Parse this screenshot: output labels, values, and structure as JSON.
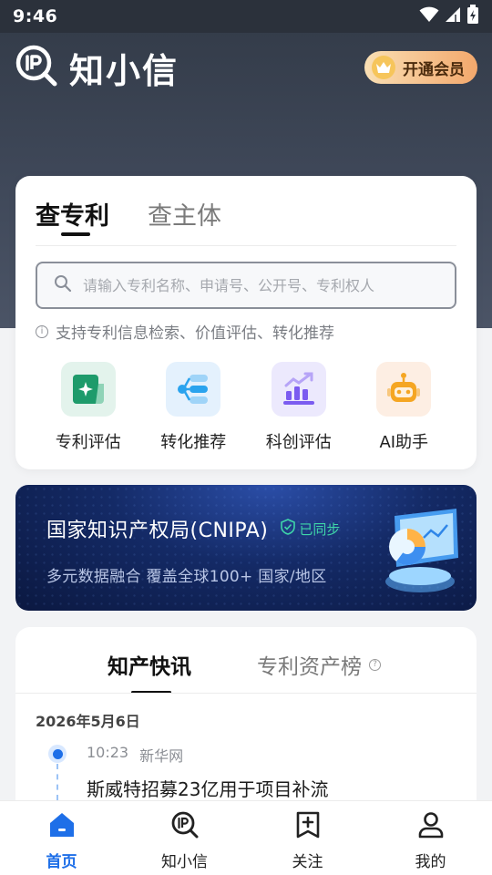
{
  "status_bar": {
    "time": "9:46"
  },
  "header": {
    "app_name": "知小信",
    "vip_label": "开通会员"
  },
  "search": {
    "tabs": [
      {
        "label": "查专利",
        "active": true
      },
      {
        "label": "查主体",
        "active": false
      }
    ],
    "placeholder": "请输入专利名称、申请号、公开号、专利权人",
    "hint": "支持专利信息检索、价值评估、转化推荐",
    "tools": [
      {
        "label": "专利评估",
        "icon": "patent-evaluate-icon",
        "bg": "#e3f3ec",
        "color": "#1e9b6b"
      },
      {
        "label": "转化推荐",
        "icon": "transfer-recommend-icon",
        "bg": "#e4f1fd",
        "color": "#2aa3ee"
      },
      {
        "label": "科创评估",
        "icon": "tech-evaluate-icon",
        "bg": "#ece9fd",
        "color": "#7b5cf0"
      },
      {
        "label": "AI助手",
        "icon": "ai-robot-icon",
        "bg": "#fdeee3",
        "color": "#f5a623"
      }
    ]
  },
  "banner": {
    "title": "国家知识产权局(CNIPA)",
    "synced": "已同步",
    "subtitle": "多元数据融合 覆盖全球100+ 国家/地区"
  },
  "news": {
    "tabs": [
      {
        "label": "知产快讯",
        "active": true
      },
      {
        "label": "专利资产榜",
        "active": false
      }
    ],
    "date": "2026年5月6日",
    "items": [
      {
        "time": "10:23",
        "source": "新华网",
        "title": "斯威特招募23亿用于项目补流"
      }
    ]
  },
  "nav": {
    "items": [
      {
        "label": "首页",
        "icon": "home-icon",
        "active": true
      },
      {
        "label": "知小信",
        "icon": "ip-search-icon",
        "active": false
      },
      {
        "label": "关注",
        "icon": "follow-icon",
        "active": false
      },
      {
        "label": "我的",
        "icon": "user-icon",
        "active": false
      }
    ]
  },
  "colors": {
    "accent": "#1e6fe8",
    "header_bg": "#3a4252",
    "vip_gradient_start": "#f9dfb4",
    "vip_gradient_end": "#f3a86c",
    "synced_green": "#3fd6a9"
  }
}
